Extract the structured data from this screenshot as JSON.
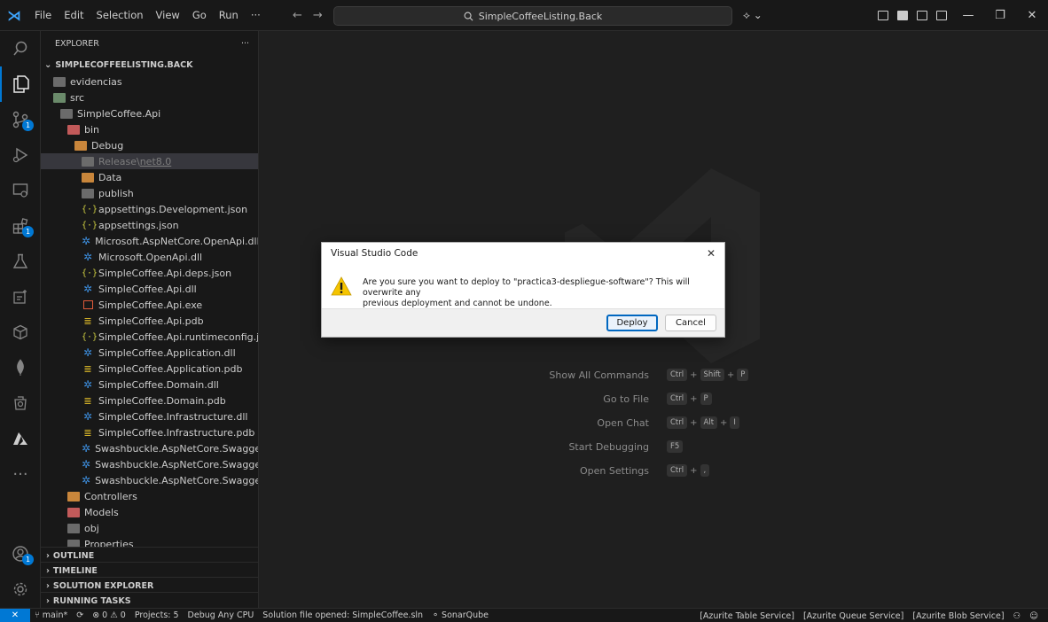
{
  "titlebar": {
    "menu": [
      "File",
      "Edit",
      "Selection",
      "View",
      "Go",
      "Run",
      "···"
    ],
    "search": "SimpleCoffeeListing.Back"
  },
  "activity": {
    "badges": {
      "scm": "1",
      "extensions": "1",
      "accounts": "1"
    }
  },
  "explorer": {
    "title": "EXPLORER",
    "more": "···",
    "root": "SIMPLECOFFEELISTING.BACK",
    "items": [
      {
        "label": "evidencias",
        "indent": 0,
        "icon": "folder"
      },
      {
        "label": "src",
        "indent": 0,
        "icon": "folder-src"
      },
      {
        "label": "SimpleCoffee.Api",
        "indent": 1,
        "icon": "folder"
      },
      {
        "label": "bin",
        "indent": 2,
        "icon": "folder-red"
      },
      {
        "label": "Debug",
        "indent": 3,
        "icon": "folder-orange"
      },
      {
        "label": "Release",
        "suffix": "net8.0",
        "indent": 4,
        "icon": "folder",
        "selected": true
      },
      {
        "label": "Data",
        "indent": 4,
        "icon": "folder-orange"
      },
      {
        "label": "publish",
        "indent": 4,
        "icon": "folder"
      },
      {
        "label": "appsettings.Development.json",
        "indent": 4,
        "icon": "json"
      },
      {
        "label": "appsettings.json",
        "indent": 4,
        "icon": "json"
      },
      {
        "label": "Microsoft.AspNetCore.OpenApi.dll",
        "indent": 4,
        "icon": "gear"
      },
      {
        "label": "Microsoft.OpenApi.dll",
        "indent": 4,
        "icon": "gear"
      },
      {
        "label": "SimpleCoffee.Api.deps.json",
        "indent": 4,
        "icon": "json"
      },
      {
        "label": "SimpleCoffee.Api.dll",
        "indent": 4,
        "icon": "gear"
      },
      {
        "label": "SimpleCoffee.Api.exe",
        "indent": 4,
        "icon": "exe"
      },
      {
        "label": "SimpleCoffee.Api.pdb",
        "indent": 4,
        "icon": "db"
      },
      {
        "label": "SimpleCoffee.Api.runtimeconfig.json",
        "indent": 4,
        "icon": "json"
      },
      {
        "label": "SimpleCoffee.Application.dll",
        "indent": 4,
        "icon": "gear"
      },
      {
        "label": "SimpleCoffee.Application.pdb",
        "indent": 4,
        "icon": "db"
      },
      {
        "label": "SimpleCoffee.Domain.dll",
        "indent": 4,
        "icon": "gear"
      },
      {
        "label": "SimpleCoffee.Domain.pdb",
        "indent": 4,
        "icon": "db"
      },
      {
        "label": "SimpleCoffee.Infrastructure.dll",
        "indent": 4,
        "icon": "gear"
      },
      {
        "label": "SimpleCoffee.Infrastructure.pdb",
        "indent": 4,
        "icon": "db"
      },
      {
        "label": "Swashbuckle.AspNetCore.Swagger.dll",
        "indent": 4,
        "icon": "gear"
      },
      {
        "label": "Swashbuckle.AspNetCore.SwaggerGen....",
        "indent": 4,
        "icon": "gear"
      },
      {
        "label": "Swashbuckle.AspNetCore.SwaggerUI.dll",
        "indent": 4,
        "icon": "gear"
      },
      {
        "label": "Controllers",
        "indent": 2,
        "icon": "folder-orange"
      },
      {
        "label": "Models",
        "indent": 2,
        "icon": "folder-red"
      },
      {
        "label": "obj",
        "indent": 2,
        "icon": "folder"
      },
      {
        "label": "Properties",
        "indent": 2,
        "icon": "folder"
      }
    ],
    "sections": [
      "OUTLINE",
      "TIMELINE",
      "SOLUTION EXPLORER",
      "RUNNING TASKS"
    ]
  },
  "hints": [
    {
      "label": "Show All Commands",
      "keys": [
        "Ctrl",
        "Shift",
        "P"
      ]
    },
    {
      "label": "Go to File",
      "keys": [
        "Ctrl",
        "P"
      ]
    },
    {
      "label": "Open Chat",
      "keys": [
        "Ctrl",
        "Alt",
        "I"
      ]
    },
    {
      "label": "Start Debugging",
      "keys": [
        "F5"
      ]
    },
    {
      "label": "Open Settings",
      "keys": [
        "Ctrl",
        ","
      ]
    }
  ],
  "dialog": {
    "title": "Visual Studio Code",
    "close": "✕",
    "message_line1": "Are you sure you want to deploy to \"practica3-despliegue-software\"? This will overwrite any",
    "message_line2": "previous deployment and cannot be undone.",
    "deploy_label": "Deploy",
    "cancel_label": "Cancel"
  },
  "status": {
    "remote": "✕",
    "branch": "main*",
    "problems": "⊗ 0 ⚠ 0",
    "projects": "Projects: 5",
    "config": "Debug Any CPU",
    "solution": "Solution file opened: SimpleCoffee.sln",
    "sonar": "SonarQube",
    "right": [
      "[Azurite Table Service]",
      "[Azurite Queue Service]",
      "[Azurite Blob Service]"
    ]
  },
  "colors": {
    "accent": "#0078d4",
    "background": "#1f1f1f",
    "sidebar": "#181818"
  }
}
